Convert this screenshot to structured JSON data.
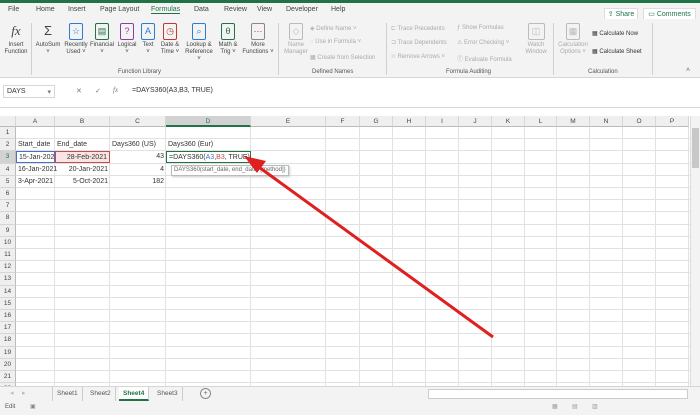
{
  "ribbon_tabs": [
    "File",
    "Home",
    "Insert",
    "Page Layout",
    "Formulas",
    "Data",
    "Review",
    "View",
    "Developer",
    "Help"
  ],
  "share": "Share",
  "comments": "Comments",
  "function_library": {
    "buttons": [
      {
        "l1": "Insert",
        "l2": "Function",
        "icon": "fx"
      },
      {
        "l1": "AutoSum",
        "l2": "˅",
        "icon": "Σ"
      },
      {
        "l1": "Recently",
        "l2": "Used ˅",
        "icon": "☆"
      },
      {
        "l1": "Financial",
        "l2": "˅",
        "icon": "▤"
      },
      {
        "l1": "Logical",
        "l2": "˅",
        "icon": "?"
      },
      {
        "l1": "Text",
        "l2": "˅",
        "icon": "A"
      },
      {
        "l1": "Date &",
        "l2": "Time ˅",
        "icon": "◷"
      },
      {
        "l1": "Lookup &",
        "l2": "Reference ˅",
        "icon": "⌕"
      },
      {
        "l1": "Math &",
        "l2": "Trig ˅",
        "icon": "θ"
      },
      {
        "l1": "More",
        "l2": "Functions ˅",
        "icon": "⋯"
      }
    ],
    "label": "Function Library"
  },
  "defined_names": {
    "name_manager_1": "Name",
    "name_manager_2": "Manager",
    "define_name": "Define Name ˅",
    "use_in_formula": "Use in Formula ˅",
    "create_from_selection": "Create from Selection",
    "label": "Defined Names"
  },
  "formula_auditing": {
    "trace_precedents": "Trace Precedents",
    "trace_dependents": "Trace Dependents",
    "remove_arrows": "Remove Arrows ˅",
    "show_formulas": "Show Formulas",
    "error_checking": "Error Checking ˅",
    "evaluate_formula": "Evaluate Formula",
    "watch_1": "Watch",
    "watch_2": "Window",
    "label": "Formula Auditing"
  },
  "calculation": {
    "options_1": "Calculation",
    "options_2": "Options ˅",
    "calc_now": "Calculate Now",
    "calc_sheet": "Calculate Sheet",
    "label": "Calculation"
  },
  "name_box": "DAYS",
  "formula": "=DAYS360(A3,B3, TRUE)",
  "columns": [
    "A",
    "B",
    "C",
    "D",
    "E",
    "F",
    "G",
    "H",
    "I",
    "J",
    "K",
    "L",
    "M",
    "N",
    "O",
    "P"
  ],
  "rows": [
    "1",
    "2",
    "3",
    "4",
    "5",
    "6",
    "7",
    "8",
    "9",
    "10",
    "11",
    "12",
    "13",
    "14",
    "15",
    "16",
    "17",
    "18",
    "19",
    "20",
    "21",
    "22"
  ],
  "cells": {
    "headers": [
      "Start_date",
      "End_date",
      "Days360 (US)",
      "Days360 (Eur)"
    ],
    "data": [
      [
        "15-Jan-2021",
        "28-Feb-2021",
        "43"
      ],
      [
        "16-Jan-2021",
        "20-Jan-2021",
        "4"
      ],
      [
        "3-Apr-2021",
        "5-Oct-2021",
        "182"
      ]
    ],
    "editing": {
      "pre": "=DAYS360(",
      "a": "A3",
      "comma": ",",
      "b": "B3",
      "post": ", TRUE)"
    }
  },
  "tooltip": "DAYS360(start_date, end_date, [method])",
  "sheets": [
    "Sheet1",
    "Sheet2",
    "Sheet4",
    "Sheet3"
  ],
  "active_sheet": "Sheet4",
  "status": "Edit"
}
